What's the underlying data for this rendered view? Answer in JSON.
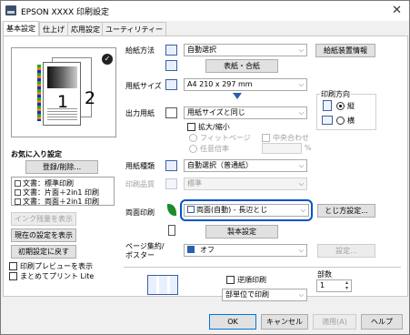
{
  "window": {
    "title": "EPSON XXXX 印刷設定",
    "close_glyph": "✕"
  },
  "tabs": [
    {
      "label": "基本設定"
    },
    {
      "label": "仕上げ"
    },
    {
      "label": "応用設定"
    },
    {
      "label": "ユーティリティー"
    }
  ],
  "preview": {
    "num1": "1",
    "num2": "2"
  },
  "favorites": {
    "heading": "お気に入り設定",
    "register_button": "登録/削除...",
    "items": [
      "文書：標準印刷",
      "文書：片面＋2in1 印刷",
      "文書：両面＋2in1 印刷"
    ]
  },
  "left_buttons": {
    "ink_level": "インク残量を表示",
    "show_current": "現在の設定を表示",
    "reset": "初期設定に戻す"
  },
  "left_checks": {
    "print_preview": "印刷プレビューを表示",
    "batch_print": "まとめてプリント Lite"
  },
  "paper_source": {
    "label": "給紙方法",
    "value": "自動選択",
    "info_button": "給紙装置情報",
    "cover_button": "表紙・合紙"
  },
  "paper_size": {
    "label": "用紙サイズ",
    "value": "A4 210 x 297 mm"
  },
  "orientation": {
    "label": "印刷方向",
    "portrait": "縦",
    "landscape": "横"
  },
  "output_paper": {
    "label": "出力用紙",
    "value": "用紙サイズと同じ",
    "reduce_enlarge": "拡大/縮小",
    "fit_page": "フィットページ",
    "center": "中央合わせ",
    "any_scale": "任意倍率",
    "percent": "%"
  },
  "paper_type": {
    "label": "用紙種類",
    "value": "自動選択（普通紙）"
  },
  "quality": {
    "label": "印刷品質",
    "value": "標準"
  },
  "duplex": {
    "label": "両面印刷",
    "value": "両面(自動) - 長辺とじ",
    "binding_button": "とじ方設定...",
    "booklet_button": "製本設定"
  },
  "multipage": {
    "label": "ページ集約/\nポスター",
    "value": "オフ",
    "settings_button": "設定..."
  },
  "reverse": {
    "label": "逆順印刷"
  },
  "collate": {
    "value": "部単位で印刷"
  },
  "copies": {
    "label": "部数",
    "value": "1"
  },
  "footer": {
    "ok": "OK",
    "cancel": "キャンセル",
    "apply": "適用(A)",
    "help": "ヘルプ"
  },
  "colors": {
    "accent": "#0066cc",
    "focus_border": "#0055c8",
    "leaf": "#1f8a2d"
  }
}
